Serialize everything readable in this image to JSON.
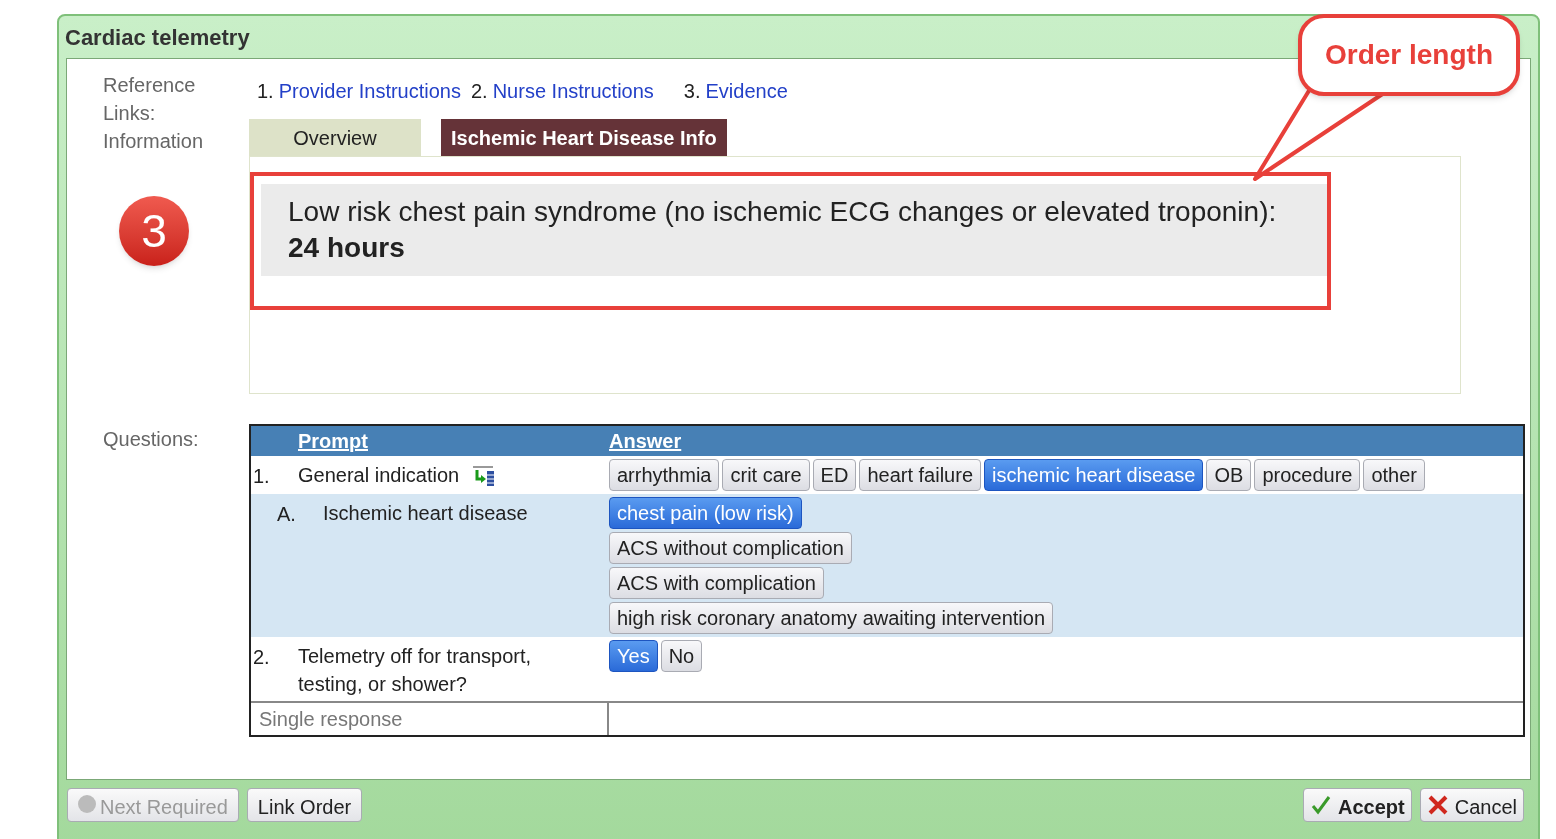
{
  "window": {
    "title": "Cardiac telemetry"
  },
  "reference_links": {
    "label": "Reference Links:",
    "items": [
      {
        "number": "1.",
        "text": "Provider Instructions"
      },
      {
        "number": "2.",
        "text": "Nurse Instructions"
      },
      {
        "number": "3.",
        "text": "Evidence"
      }
    ]
  },
  "information": {
    "label": "Information",
    "tabs": [
      {
        "label": "Overview",
        "selected": false
      },
      {
        "label": "Ischemic Heart Disease Info",
        "selected": true
      }
    ],
    "content": "Low risk chest pain syndrome (no ischemic ECG changes or elevated troponin): **24 hours**"
  },
  "questions": {
    "label": "Questions:",
    "columns": [
      "Prompt",
      "Answer"
    ],
    "rows": [
      {
        "kind": "question",
        "number": "1.",
        "prompt": "General indication",
        "answers": [
          {
            "label": "arrhythmia",
            "selected": false
          },
          {
            "label": "crit care",
            "selected": false
          },
          {
            "label": "ED",
            "selected": false
          },
          {
            "label": "heart failure",
            "selected": false
          },
          {
            "label": "ischemic heart disease",
            "selected": true
          },
          {
            "label": "OB",
            "selected": false
          },
          {
            "label": "procedure",
            "selected": false
          },
          {
            "label": "other",
            "selected": false
          }
        ]
      },
      {
        "kind": "subquestion",
        "number": "A.",
        "prompt": "Ischemic heart disease",
        "answers": [
          {
            "label": "chest pain (low risk)",
            "selected": true
          },
          {
            "label": "ACS without complication",
            "selected": false
          },
          {
            "label": "ACS with complication",
            "selected": false
          },
          {
            "label": "high risk coronary anatomy awaiting intervention",
            "selected": false
          }
        ]
      },
      {
        "kind": "question",
        "number": "2.",
        "prompt": "Telemetry off for transport, testing, or shower?",
        "answers": [
          {
            "label": "Yes",
            "selected": true
          },
          {
            "label": "No",
            "selected": false
          }
        ]
      }
    ],
    "response_type": "Single response"
  },
  "footer": {
    "left_buttons": [
      {
        "label": "Next Required",
        "disabled": true
      },
      {
        "label": "Link Order",
        "disabled": false
      }
    ],
    "right_buttons": [
      {
        "kind": "accept",
        "label": "Accept"
      },
      {
        "kind": "cancel",
        "label": "Cancel"
      }
    ]
  },
  "annotations": {
    "step_badge": "3",
    "callout": "Order length"
  }
}
